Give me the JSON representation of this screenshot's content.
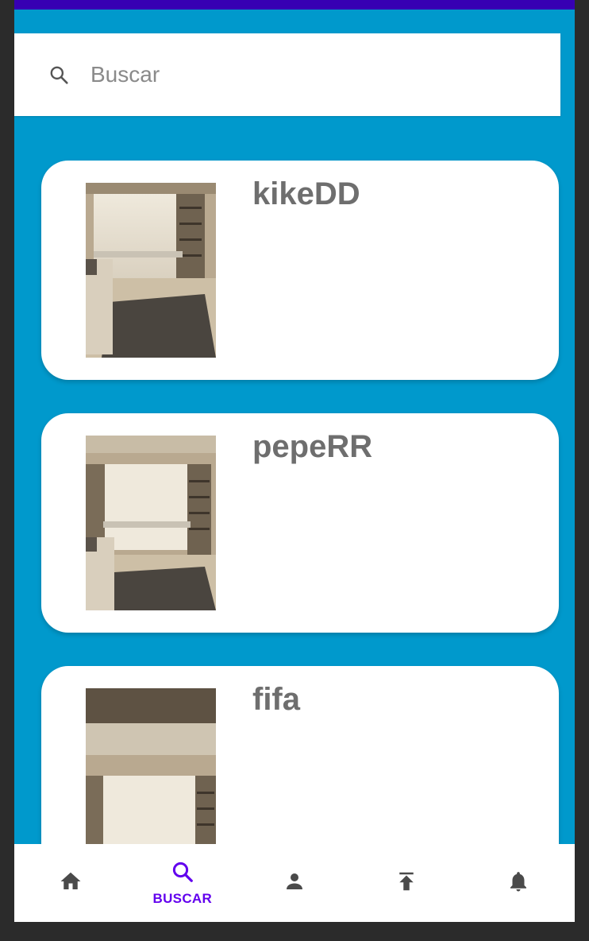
{
  "search": {
    "placeholder": "Buscar",
    "icon": "search-icon"
  },
  "results": [
    {
      "name": "kikeDD"
    },
    {
      "name": "pepeRR"
    },
    {
      "name": "fifa"
    }
  ],
  "bottom_nav": {
    "items": [
      {
        "icon": "home-icon",
        "label": ""
      },
      {
        "icon": "search-icon",
        "label": "BUSCAR",
        "active": true
      },
      {
        "icon": "person-icon",
        "label": ""
      },
      {
        "icon": "upload-icon",
        "label": ""
      },
      {
        "icon": "bell-icon",
        "label": ""
      }
    ]
  },
  "colors": {
    "background": "#0099CC",
    "accent": "#6200EE",
    "status_bar": "#3700B3",
    "icon_inactive": "#4a4a4a"
  }
}
